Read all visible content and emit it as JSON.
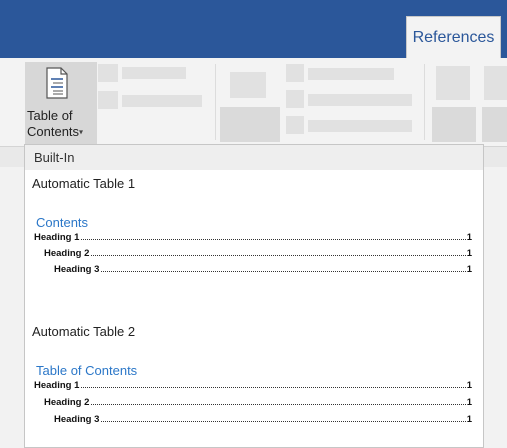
{
  "ribbon": {
    "active_tab": "References",
    "toc_button_line1": "Table of",
    "toc_button_line2": "Contents",
    "toc_caret": "▾"
  },
  "gallery": {
    "section_header": "Built-In",
    "items": [
      {
        "option_label": "Automatic Table 1",
        "preview_title": "Contents",
        "entries": [
          {
            "text": "Heading 1",
            "page": "1"
          },
          {
            "text": "Heading 2",
            "page": "1"
          },
          {
            "text": "Heading 3",
            "page": "1"
          }
        ]
      },
      {
        "option_label": "Automatic Table 2",
        "preview_title": "Table of Contents",
        "entries": [
          {
            "text": "Heading 1",
            "page": "1"
          },
          {
            "text": "Heading 2",
            "page": "1"
          },
          {
            "text": "Heading 3",
            "page": "1"
          }
        ]
      }
    ]
  },
  "colors": {
    "titlebar": "#2b579a",
    "ribbon": "#f3f3f3",
    "preview_title": "#2b77c8"
  }
}
